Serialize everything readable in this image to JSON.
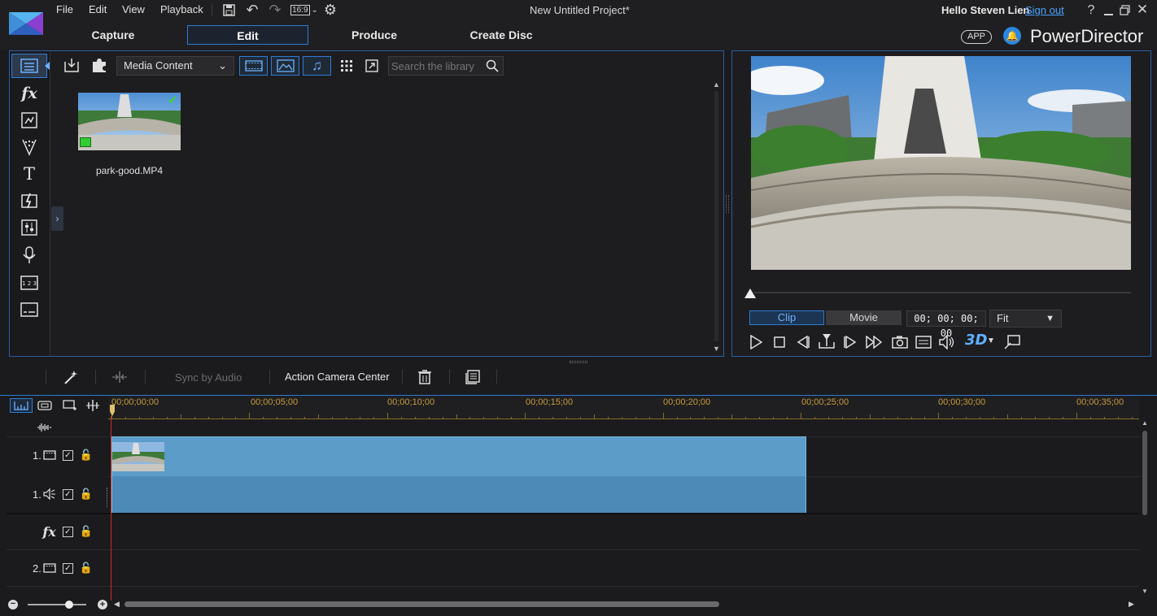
{
  "window": {
    "title": "New Untitled Project*",
    "greeting": "Hello Steven Lien",
    "signout": "Sign out",
    "brand": "PowerDirector",
    "app_badge": "APP"
  },
  "menu": {
    "file": "File",
    "edit": "Edit",
    "view": "View",
    "playback": "Playback",
    "aspect": "16:9"
  },
  "tabs": {
    "capture": "Capture",
    "edit": "Edit",
    "produce": "Produce",
    "create_disc": "Create Disc"
  },
  "library": {
    "dropdown_value": "Media Content",
    "search_placeholder": "Search the library",
    "items": [
      {
        "name": "park-good.MP4"
      }
    ]
  },
  "preview": {
    "clip_label": "Clip",
    "movie_label": "Movie",
    "timecode": "00; 00; 00; 00",
    "fit_value": "Fit",
    "three_d": "3D"
  },
  "timeline_toolbar": {
    "sync_by_audio": "Sync by Audio",
    "action_camera_center": "Action Camera Center"
  },
  "ruler": [
    "00;00;00;00",
    "00;00;05;00",
    "00;00;10;00",
    "00;00;15;00",
    "00;00;20;00",
    "00;00;25;00",
    "00;00;30;00",
    "00;00;35;00"
  ],
  "tracks": [
    {
      "label": "1.",
      "type": "video"
    },
    {
      "label": "1.",
      "type": "audio"
    },
    {
      "label": "",
      "type": "fx"
    },
    {
      "label": "2.",
      "type": "video"
    }
  ],
  "colors": {
    "accent": "#2e7bd6",
    "clip": "#4f8fc0",
    "ruler_text": "#c89b3c",
    "playhead": "#c0302a"
  }
}
